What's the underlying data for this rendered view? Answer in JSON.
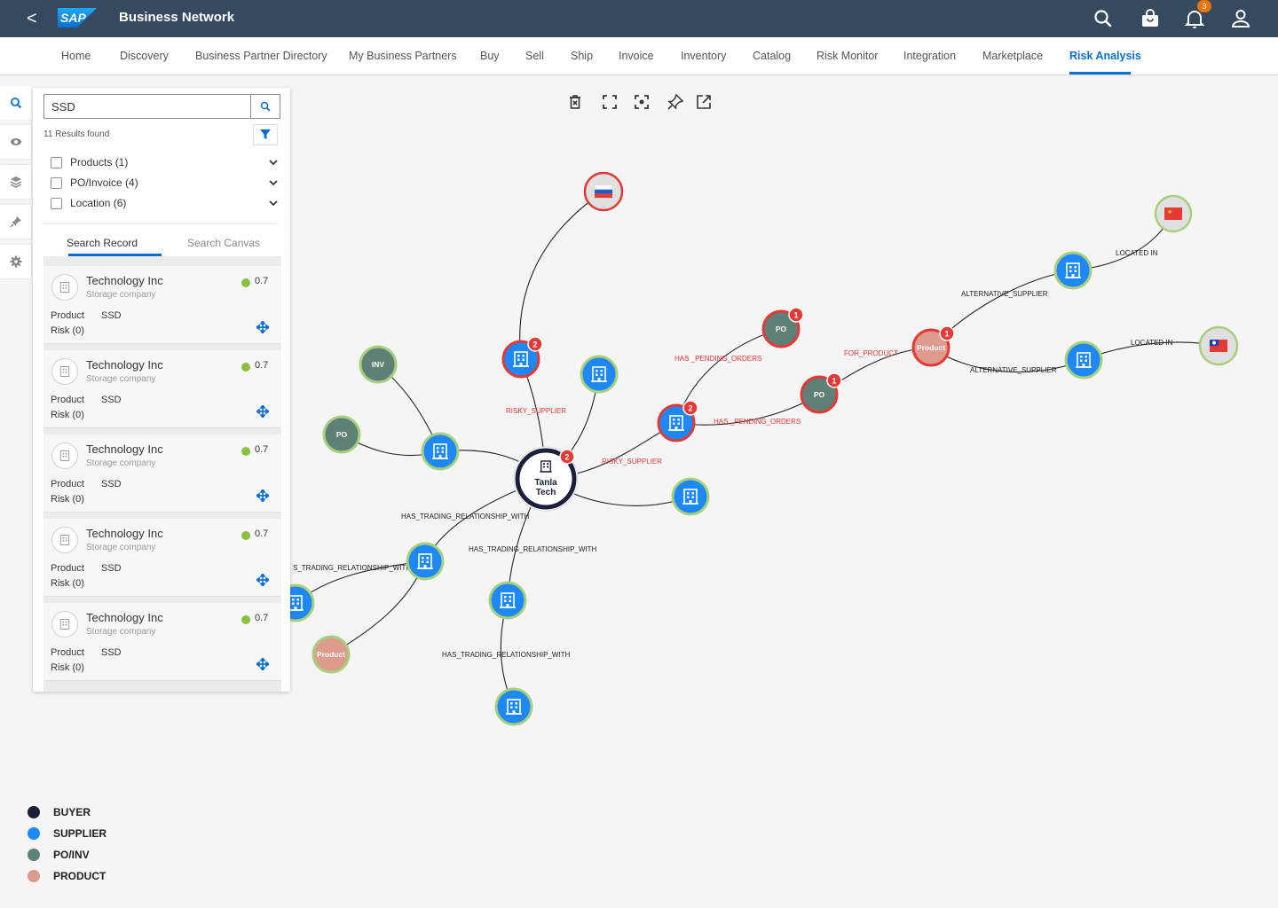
{
  "shell": {
    "back_label": "<",
    "logo_text": "SAP",
    "title": "Business Network",
    "notification_count": "3",
    "icons": [
      "search-icon",
      "shopping-bag-icon",
      "bell-icon",
      "user-icon"
    ]
  },
  "nav": {
    "items": [
      "Home",
      "Discovery",
      "Business Partner Directory",
      "My Business Partners",
      "Buy",
      "Sell",
      "Ship",
      "Invoice",
      "Inventory",
      "Catalog",
      "Risk Monitor",
      "Integration",
      "Marketplace",
      "Risk Analysis"
    ],
    "active": "Risk Analysis"
  },
  "sidebar": {
    "tools": [
      "search-icon",
      "eye-icon",
      "layers-icon",
      "pin-icon",
      "gear-icon"
    ]
  },
  "search": {
    "value": "SSD",
    "results_text": "11 Results found",
    "facets": [
      {
        "label": "Products (1)"
      },
      {
        "label": "PO/Invoice (4)"
      },
      {
        "label": "Location (6)"
      }
    ],
    "tabs": [
      "Search Record",
      "Search Canvas"
    ],
    "active_tab": "Search Record"
  },
  "results": [
    {
      "name": "Technology Inc",
      "subtitle": "Storage company",
      "score": "0.7",
      "product_label": "Product",
      "product_value": "SSD",
      "risk_label": "Risk (0)"
    },
    {
      "name": "Technology Inc",
      "subtitle": "Storage company",
      "score": "0.7",
      "product_label": "Product",
      "product_value": "SSD",
      "risk_label": "Risk (0)"
    },
    {
      "name": "Technology Inc",
      "subtitle": "Storage company",
      "score": "0.7",
      "product_label": "Product",
      "product_value": "SSD",
      "risk_label": "Risk (0)"
    },
    {
      "name": "Technology Inc",
      "subtitle": "Storage company",
      "score": "0.7",
      "product_label": "Product",
      "product_value": "SSD",
      "risk_label": "Risk (0)"
    },
    {
      "name": "Technology Inc",
      "subtitle": "Storage company",
      "score": "0.7",
      "product_label": "Product",
      "product_value": "SSD",
      "risk_label": "Risk (0)"
    }
  ],
  "canvas_tools": [
    "delete-icon",
    "expand-icon",
    "focus-icon",
    "pin-icon",
    "open-external-icon"
  ],
  "graph": {
    "center": {
      "line1": "Tanla",
      "line2": "Tech",
      "badge": "2"
    },
    "node_labels": {
      "po": "PO",
      "inv": "INV",
      "product": "Product"
    },
    "badges": {
      "risky_supplier": "2",
      "po_top": "1",
      "supplier_mid": "2",
      "po_mid": "1",
      "product": "1"
    },
    "edge_labels": {
      "risky_supplier": "RISKY_SUPPLIER",
      "has_pending_orders": "HAS _PENDING_ORDERS",
      "for_product": "FOR_PRODUCT",
      "alternative_supplier": "ALTERNATIVE_SUPPLIER",
      "located_in": "LOCATED IN",
      "has_trading": "HAS_TRADING_RELATIONSHIP_WITH",
      "has_trading_clipped": "S_TRADING_RELATIONSHIP_WITH"
    }
  },
  "legend": [
    {
      "label": "BUYER",
      "color": "#1b1f3b"
    },
    {
      "label": "SUPPLIER",
      "color": "#1e88f5"
    },
    {
      "label": "PO/INV",
      "color": "#5e8078"
    },
    {
      "label": "PRODUCT",
      "color": "#de9a8d"
    }
  ]
}
